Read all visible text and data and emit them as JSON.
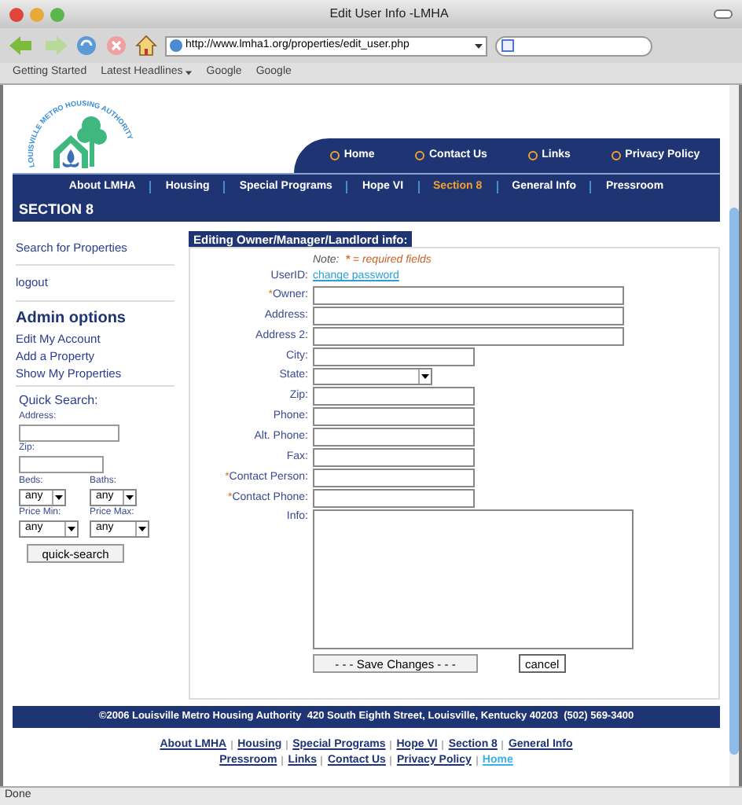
{
  "window": {
    "title": "Edit User Info -LMHA"
  },
  "toolbar": {
    "url": "http://www.lmha1.org/properties/edit_user.php"
  },
  "bookmarks": [
    {
      "label": "Getting Started",
      "menu": false
    },
    {
      "label": "Latest Headlines",
      "menu": true
    },
    {
      "label": "Google",
      "menu": false
    },
    {
      "label": "Google",
      "menu": false
    }
  ],
  "logo": {
    "text": "LOUISVILLE METRO HOUSING AUTHORITY"
  },
  "top_links": [
    "Home",
    "Contact Us",
    "Links",
    "Privacy Policy"
  ],
  "nav": [
    {
      "label": "About LMHA",
      "selected": false
    },
    {
      "label": "Housing",
      "selected": false
    },
    {
      "label": "Special Programs",
      "selected": false
    },
    {
      "label": "Hope VI",
      "selected": false
    },
    {
      "label": "Section 8",
      "selected": true
    },
    {
      "label": "General Info",
      "selected": false
    },
    {
      "label": "Pressroom",
      "selected": false
    }
  ],
  "section_title": "SECTION 8",
  "sidebar": {
    "links": [
      "Search for Properties",
      "logout"
    ],
    "admin_title": "Admin options",
    "admin_links": [
      "Edit My Account",
      "Add a Property",
      "Show My Properties"
    ],
    "quick_search": {
      "title": "Quick Search:",
      "fields": [
        "Address:",
        "Zip:"
      ],
      "selects": [
        {
          "label": "Beds:",
          "value": "any"
        },
        {
          "label": "Baths:",
          "value": "any"
        },
        {
          "label": "Price Min:",
          "value": "any"
        },
        {
          "label": "Price Max:",
          "value": "any"
        }
      ],
      "button": "quick-search"
    }
  },
  "form": {
    "title": "Editing Owner/Manager/Landlord info:",
    "note_label": "Note:",
    "note_mark": "*",
    "note_text": "= required fields",
    "userid_label": "UserID:",
    "password_link": "change password",
    "fields": [
      {
        "label": "Owner:",
        "required": true,
        "kind": "long"
      },
      {
        "label": "Address:",
        "required": false,
        "kind": "long"
      },
      {
        "label": "Address 2:",
        "required": false,
        "kind": "long"
      },
      {
        "label": "City:",
        "required": false,
        "kind": "short"
      },
      {
        "label": "State:",
        "required": false,
        "kind": "select"
      },
      {
        "label": "Zip:",
        "required": false,
        "kind": "short"
      },
      {
        "label": "Phone:",
        "required": false,
        "kind": "short"
      },
      {
        "label": "Alt. Phone:",
        "required": false,
        "kind": "short"
      },
      {
        "label": "Fax:",
        "required": false,
        "kind": "short"
      },
      {
        "label": "Contact Person:",
        "required": true,
        "kind": "short"
      },
      {
        "label": "Contact Phone:",
        "required": true,
        "kind": "short"
      },
      {
        "label": "Info:",
        "required": false,
        "kind": "textarea"
      }
    ],
    "buttons": [
      "- - - Save Changes - - -",
      "cancel"
    ]
  },
  "footer": {
    "text": "©2006 Louisville Metro Housing Authority  420 South Eighth Street, Louisville, Kentucky 40203  (502) 569-3400",
    "link_rows": [
      [
        {
          "label": "About LMHA",
          "selected": false
        },
        {
          "label": "Housing",
          "selected": false
        },
        {
          "label": "Special Programs",
          "selected": false
        },
        {
          "label": "Hope VI",
          "selected": false
        },
        {
          "label": "Section 8",
          "selected": false
        },
        {
          "label": "General Info",
          "selected": false
        }
      ],
      [
        {
          "label": "Pressroom",
          "selected": false
        },
        {
          "label": "Links",
          "selected": false
        },
        {
          "label": "Contact Us",
          "selected": false
        },
        {
          "label": "Privacy Policy",
          "selected": false
        },
        {
          "label": "Home",
          "selected": true
        }
      ]
    ]
  },
  "status_bar": "Done"
}
